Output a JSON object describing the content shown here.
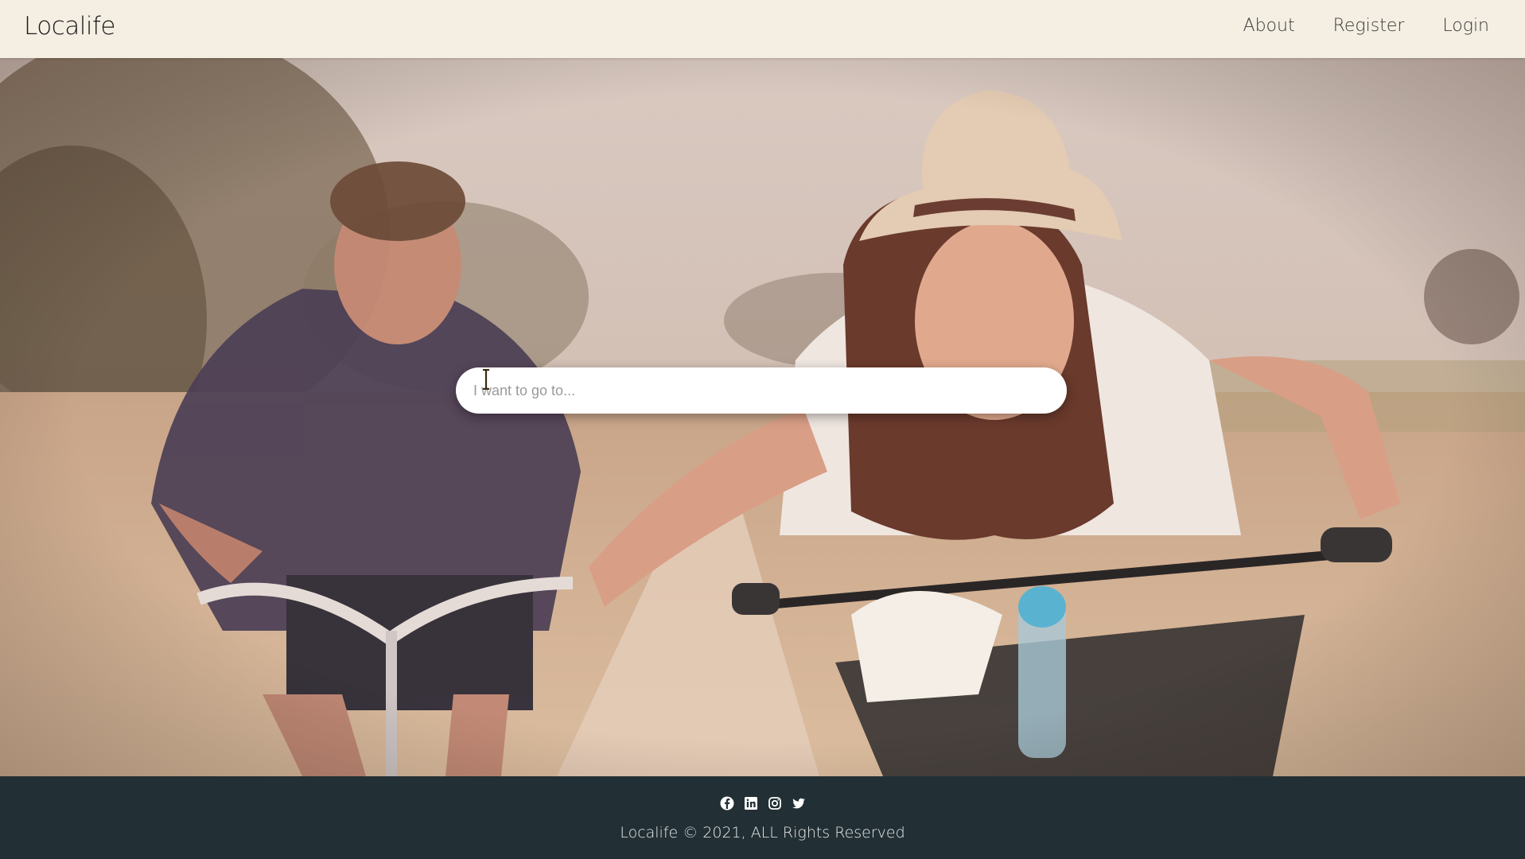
{
  "nav": {
    "brand": "Localife",
    "links": [
      {
        "label": "About"
      },
      {
        "label": "Register"
      },
      {
        "label": "Login"
      }
    ]
  },
  "hero": {
    "image": "couple-riding-bicycles-photo",
    "search": {
      "placeholder": "I want to go to...",
      "value": ""
    }
  },
  "footer": {
    "social_icons": [
      "facebook-icon",
      "linkedin-icon",
      "instagram-icon",
      "twitter-icon"
    ],
    "copyright": "Localife © 2021, ALL Rights Reserved"
  },
  "colors": {
    "navbar_bg": "#f5efe3",
    "footer_bg": "#223035",
    "search_bg": "#ffffff"
  }
}
